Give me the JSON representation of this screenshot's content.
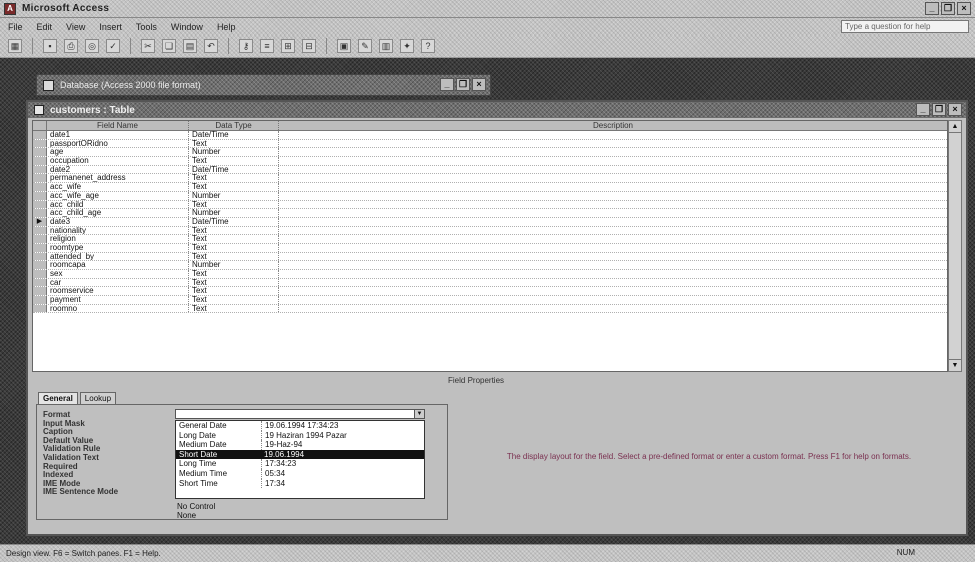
{
  "app": {
    "title": "Microsoft Access"
  },
  "menu": {
    "items": [
      "File",
      "Edit",
      "View",
      "Insert",
      "Tools",
      "Window",
      "Help"
    ],
    "help_box": "Type a question for help"
  },
  "toolbar": {
    "buttons": [
      "view",
      "save",
      "print",
      "preview",
      "spelling",
      "cut",
      "copy",
      "paste",
      "format-painter",
      "undo",
      "primary-key",
      "indexes",
      "insert-rows",
      "delete-rows",
      "properties",
      "build",
      "database-window",
      "new-object",
      "help"
    ]
  },
  "db_window": {
    "title": "Database (Access 2000 file format)"
  },
  "table_window": {
    "title": "customers : Table"
  },
  "grid": {
    "headers": {
      "field_name": "Field Name",
      "data_type": "Data Type",
      "description": "Description"
    },
    "rows": [
      {
        "name": "date1",
        "type": "Date/Time",
        "selected": false
      },
      {
        "name": "passportORidno",
        "type": "Text",
        "selected": false
      },
      {
        "name": "age",
        "type": "Number",
        "selected": false
      },
      {
        "name": "occupation",
        "type": "Text",
        "selected": false
      },
      {
        "name": "date2",
        "type": "Date/Time",
        "selected": false
      },
      {
        "name": "permanenet_address",
        "type": "Text",
        "selected": false
      },
      {
        "name": "acc_wife",
        "type": "Text",
        "selected": false
      },
      {
        "name": "acc_wife_age",
        "type": "Number",
        "selected": false
      },
      {
        "name": "acc_child",
        "type": "Text",
        "selected": false
      },
      {
        "name": "acc_child_age",
        "type": "Number",
        "selected": false
      },
      {
        "name": "date3",
        "type": "Date/Time",
        "selected": true
      },
      {
        "name": "nationality",
        "type": "Text",
        "selected": false
      },
      {
        "name": "religion",
        "type": "Text",
        "selected": false
      },
      {
        "name": "roomtype",
        "type": "Text",
        "selected": false
      },
      {
        "name": "attended_by",
        "type": "Text",
        "selected": false
      },
      {
        "name": "roomcapa",
        "type": "Number",
        "selected": false
      },
      {
        "name": "sex",
        "type": "Text",
        "selected": false
      },
      {
        "name": "car",
        "type": "Text",
        "selected": false
      },
      {
        "name": "roomservice",
        "type": "Text",
        "selected": false
      },
      {
        "name": "payment",
        "type": "Text",
        "selected": false
      },
      {
        "name": "roomno",
        "type": "Text",
        "selected": false
      }
    ]
  },
  "field_properties": {
    "heading": "Field Properties",
    "tabs": [
      "General",
      "Lookup"
    ],
    "labels": [
      "Format",
      "Input Mask",
      "Caption",
      "Default Value",
      "Validation Rule",
      "Validation Text",
      "Required",
      "Indexed",
      "IME Mode",
      "IME Sentence Mode"
    ],
    "format_options": [
      {
        "name": "General Date",
        "sample": "19.06.1994 17:34:23",
        "selected": false
      },
      {
        "name": "Long Date",
        "sample": "19 Haziran 1994 Pazar",
        "selected": false
      },
      {
        "name": "Medium Date",
        "sample": "19-Haz-94",
        "selected": false
      },
      {
        "name": "Short Date",
        "sample": "19.06.1994",
        "selected": true
      },
      {
        "name": "Long Time",
        "sample": "17:34:23",
        "selected": false
      },
      {
        "name": "Medium Time",
        "sample": "05:34",
        "selected": false
      },
      {
        "name": "Short Time",
        "sample": "17:34",
        "selected": false
      }
    ],
    "ime_mode": "No Control",
    "ime_sentence_mode": "None",
    "help_text": "The display layout for the field. Select a pre-defined format or enter a custom format. Press F1 for help on formats."
  },
  "statusbar": {
    "text": "Design view. F6 = Switch panes. F1 = Help.",
    "mode": "NUM"
  }
}
